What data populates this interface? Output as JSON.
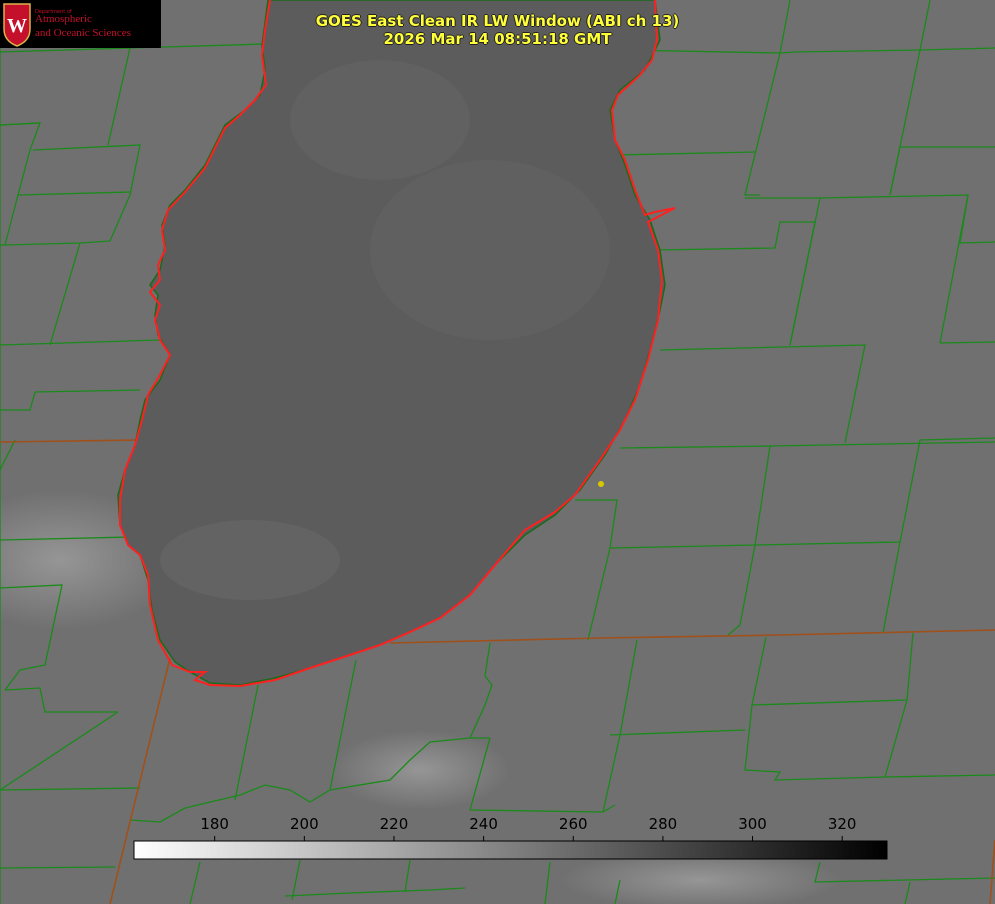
{
  "title": {
    "line1": "GOES East Clean IR LW Window (ABI ch 13)",
    "line2": "2026 Mar 14 08:51:18 GMT"
  },
  "logo": {
    "dept": "Department of",
    "line1": "Atmospheric",
    "line2": "and Oceanic Sciences",
    "shield_letter": "W"
  },
  "colorbar": {
    "ticks": [
      "180",
      "200",
      "220",
      "240",
      "260",
      "280",
      "300",
      "320"
    ],
    "tick_values": [
      180,
      200,
      220,
      240,
      260,
      280,
      300,
      320
    ],
    "range": [
      162,
      330
    ],
    "gradient": [
      "#ffffff",
      "#000000"
    ]
  },
  "colors": {
    "county_lines": "#1a8a1a",
    "state_lines": "#a0501a",
    "coastline": "#ff2020",
    "lake": "#5a5a5a",
    "land": "#6f6f6f",
    "marker": "#d8c800",
    "title": "#ffff3a"
  },
  "icons": [
    "uw-crest-icon",
    "location-marker-icon"
  ]
}
